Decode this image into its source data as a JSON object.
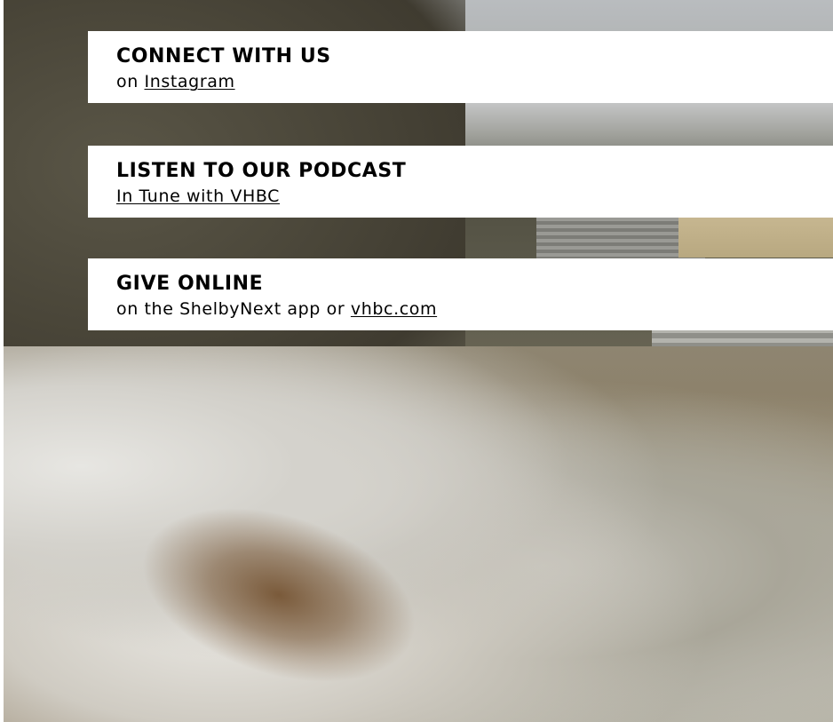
{
  "sections": {
    "connect": {
      "heading": "CONNECT WITH US",
      "prefix": "on",
      "link_text": "Instagram"
    },
    "podcast": {
      "heading": "LISTEN TO OUR PODCAST",
      "link_text": "In Tune with VHBC"
    },
    "give": {
      "heading": "GIVE ONLINE",
      "prefix": "on the ShelbyNext app or",
      "link_text": "vhbc.com"
    }
  },
  "colors": {
    "panel_background": "#ffffff",
    "text": "#000000"
  }
}
